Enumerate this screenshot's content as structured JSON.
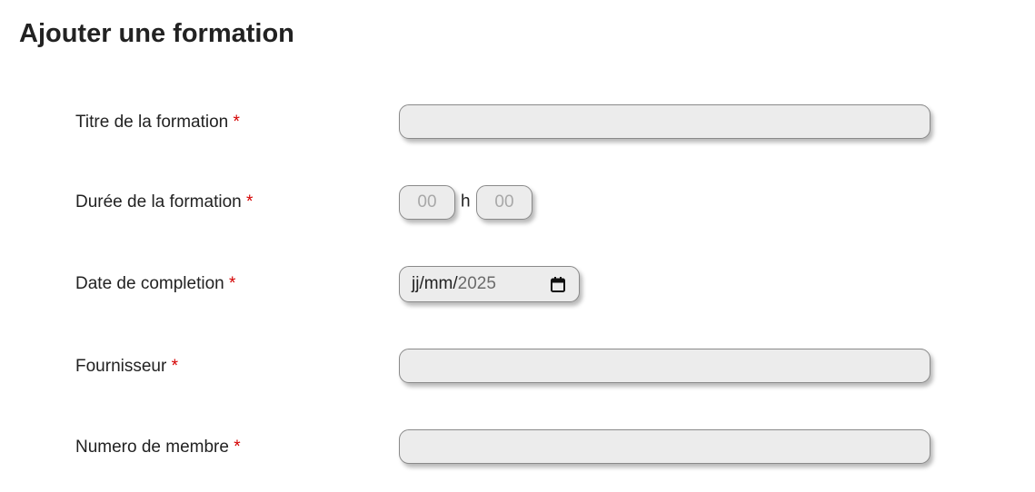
{
  "page": {
    "title": "Ajouter une formation"
  },
  "form": {
    "required_marker": "*",
    "titre": {
      "label": "Titre de la formation",
      "value": "",
      "placeholder": ""
    },
    "duree": {
      "label": "Durée de la formation",
      "hours_placeholder": "00",
      "separator": "h",
      "minutes_placeholder": "00"
    },
    "date": {
      "label": "Date de completion",
      "day_month_text": "jj/mm/",
      "year_text": "2025",
      "icon": "calendar-icon"
    },
    "fournisseur": {
      "label": "Fournisseur",
      "value": "",
      "placeholder": ""
    },
    "numero": {
      "label": "Numero de membre",
      "value": "",
      "placeholder": ""
    }
  },
  "colors": {
    "required": "#d40000",
    "input_background": "#ececec",
    "input_border": "#8a8a8a"
  }
}
